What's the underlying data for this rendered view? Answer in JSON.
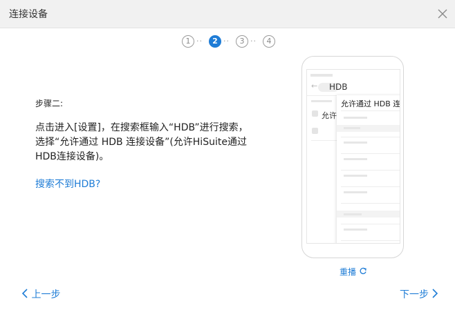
{
  "dialog": {
    "title": "连接设备",
    "close_icon": "close-icon"
  },
  "steps": {
    "items": [
      "1",
      "2",
      "3",
      "4"
    ],
    "active": "2",
    "separator": "··"
  },
  "content": {
    "step_label": "步骤二:",
    "description": "点击进入[设置]，在搜索框输入“HDB”进行搜索，选择“允许通过 HDB 连接设备”(允许HiSuite通过HDB连接设备)。",
    "help_link": "搜索不到HDB?"
  },
  "phone_preview": {
    "search_text": "HDB",
    "suggestion": "允许通过 HDB 连接设备",
    "behind_item": "允许"
  },
  "controls": {
    "replay": "重播",
    "prev": "上一步",
    "next": "下一步"
  },
  "colors": {
    "accent": "#1e7cd6",
    "titlebar": "#f1f1f1"
  }
}
